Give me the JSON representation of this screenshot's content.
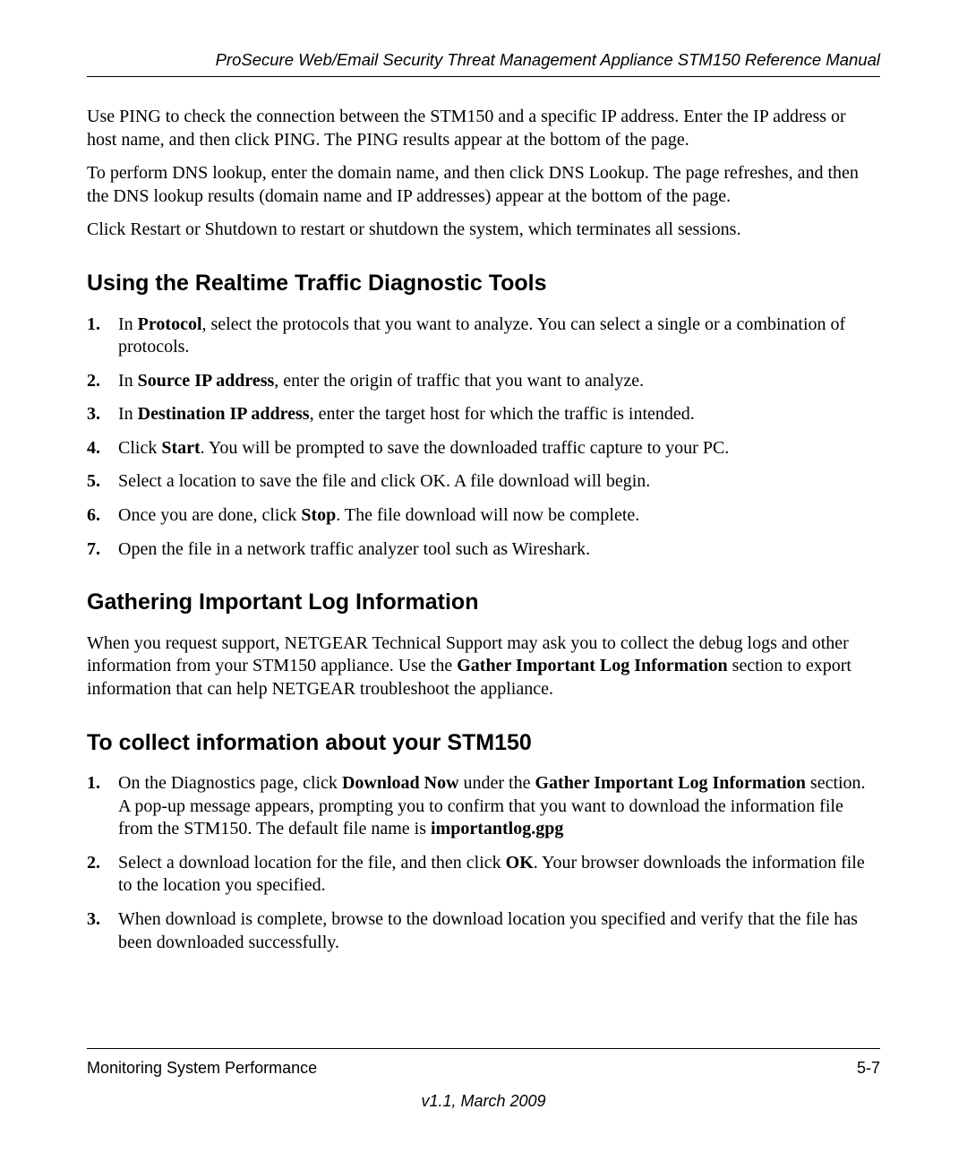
{
  "header": {
    "title": "ProSecure Web/Email Security Threat Management Appliance STM150 Reference Manual"
  },
  "intro": {
    "p1": "Use PING to check the connection between the STM150 and a specific IP address. Enter the IP address or host name, and then click PING. The PING results appear at the bottom of the page.",
    "p2": "To perform DNS lookup, enter the domain name, and then click DNS Lookup. The page refreshes, and then the DNS lookup results (domain name and IP addresses) appear at the bottom of the page.",
    "p3": "Click Restart or Shutdown to restart or shutdown the system, which terminates all sessions."
  },
  "section1": {
    "heading": "Using the Realtime Traffic Diagnostic Tools",
    "items": {
      "n1": "1.",
      "a1_pre": "In ",
      "a1_b": "Protocol",
      "a1_post": ", select the protocols that you want to analyze. You can select a single or a combination of protocols.",
      "n2": "2.",
      "a2_pre": "In ",
      "a2_b": "Source IP address",
      "a2_post": ", enter the origin of traffic that you want to analyze.",
      "n3": "3.",
      "a3_pre": "In ",
      "a3_b": "Destination IP address",
      "a3_post": ", enter the target host for which the traffic is intended.",
      "n4": "4.",
      "a4_pre": "Click ",
      "a4_b": "Start",
      "a4_post": ". You will be prompted to save the downloaded traffic capture to your PC.",
      "n5": "5.",
      "a5": "Select a location to save the file and click OK. A file download will begin.",
      "n6": "6.",
      "a6_pre": "Once you are done, click ",
      "a6_b": "Stop",
      "a6_post": ". The file download will now be complete.",
      "n7": "7.",
      "a7": "Open the file in a network traffic analyzer tool such as Wireshark."
    }
  },
  "section2": {
    "heading": "Gathering Important Log Information",
    "para_pre": "When you request support, NETGEAR Technical Support may ask you to collect the debug logs and other information from your STM150 appliance. Use the ",
    "para_b": "Gather Important Log Information",
    "para_post": " section to export information that can help NETGEAR troubleshoot the appliance."
  },
  "section3": {
    "heading": "To collect information about your STM150",
    "items": {
      "n1": "1.",
      "a1_pre": "On the Diagnostics page, click ",
      "a1_b1": "Download Now",
      "a1_mid": " under the ",
      "a1_b2": "Gather Important Log Information",
      "a1_post": " section. A pop-up message appears, prompting you to confirm that you want to download the information file from the STM150. The default file name is ",
      "a1_b3": "importantlog.gpg",
      "n2": "2.",
      "a2_pre": "Select a download location for the file, and then click ",
      "a2_b": "OK",
      "a2_post": ". Your browser downloads the information file to the location you specified.",
      "n3": "3.",
      "a3": "When download is complete, browse to the download location you specified and verify that the file has been downloaded successfully."
    }
  },
  "footer": {
    "left": "Monitoring System Performance",
    "right": "5-7",
    "version": "v1.1, March 2009"
  }
}
